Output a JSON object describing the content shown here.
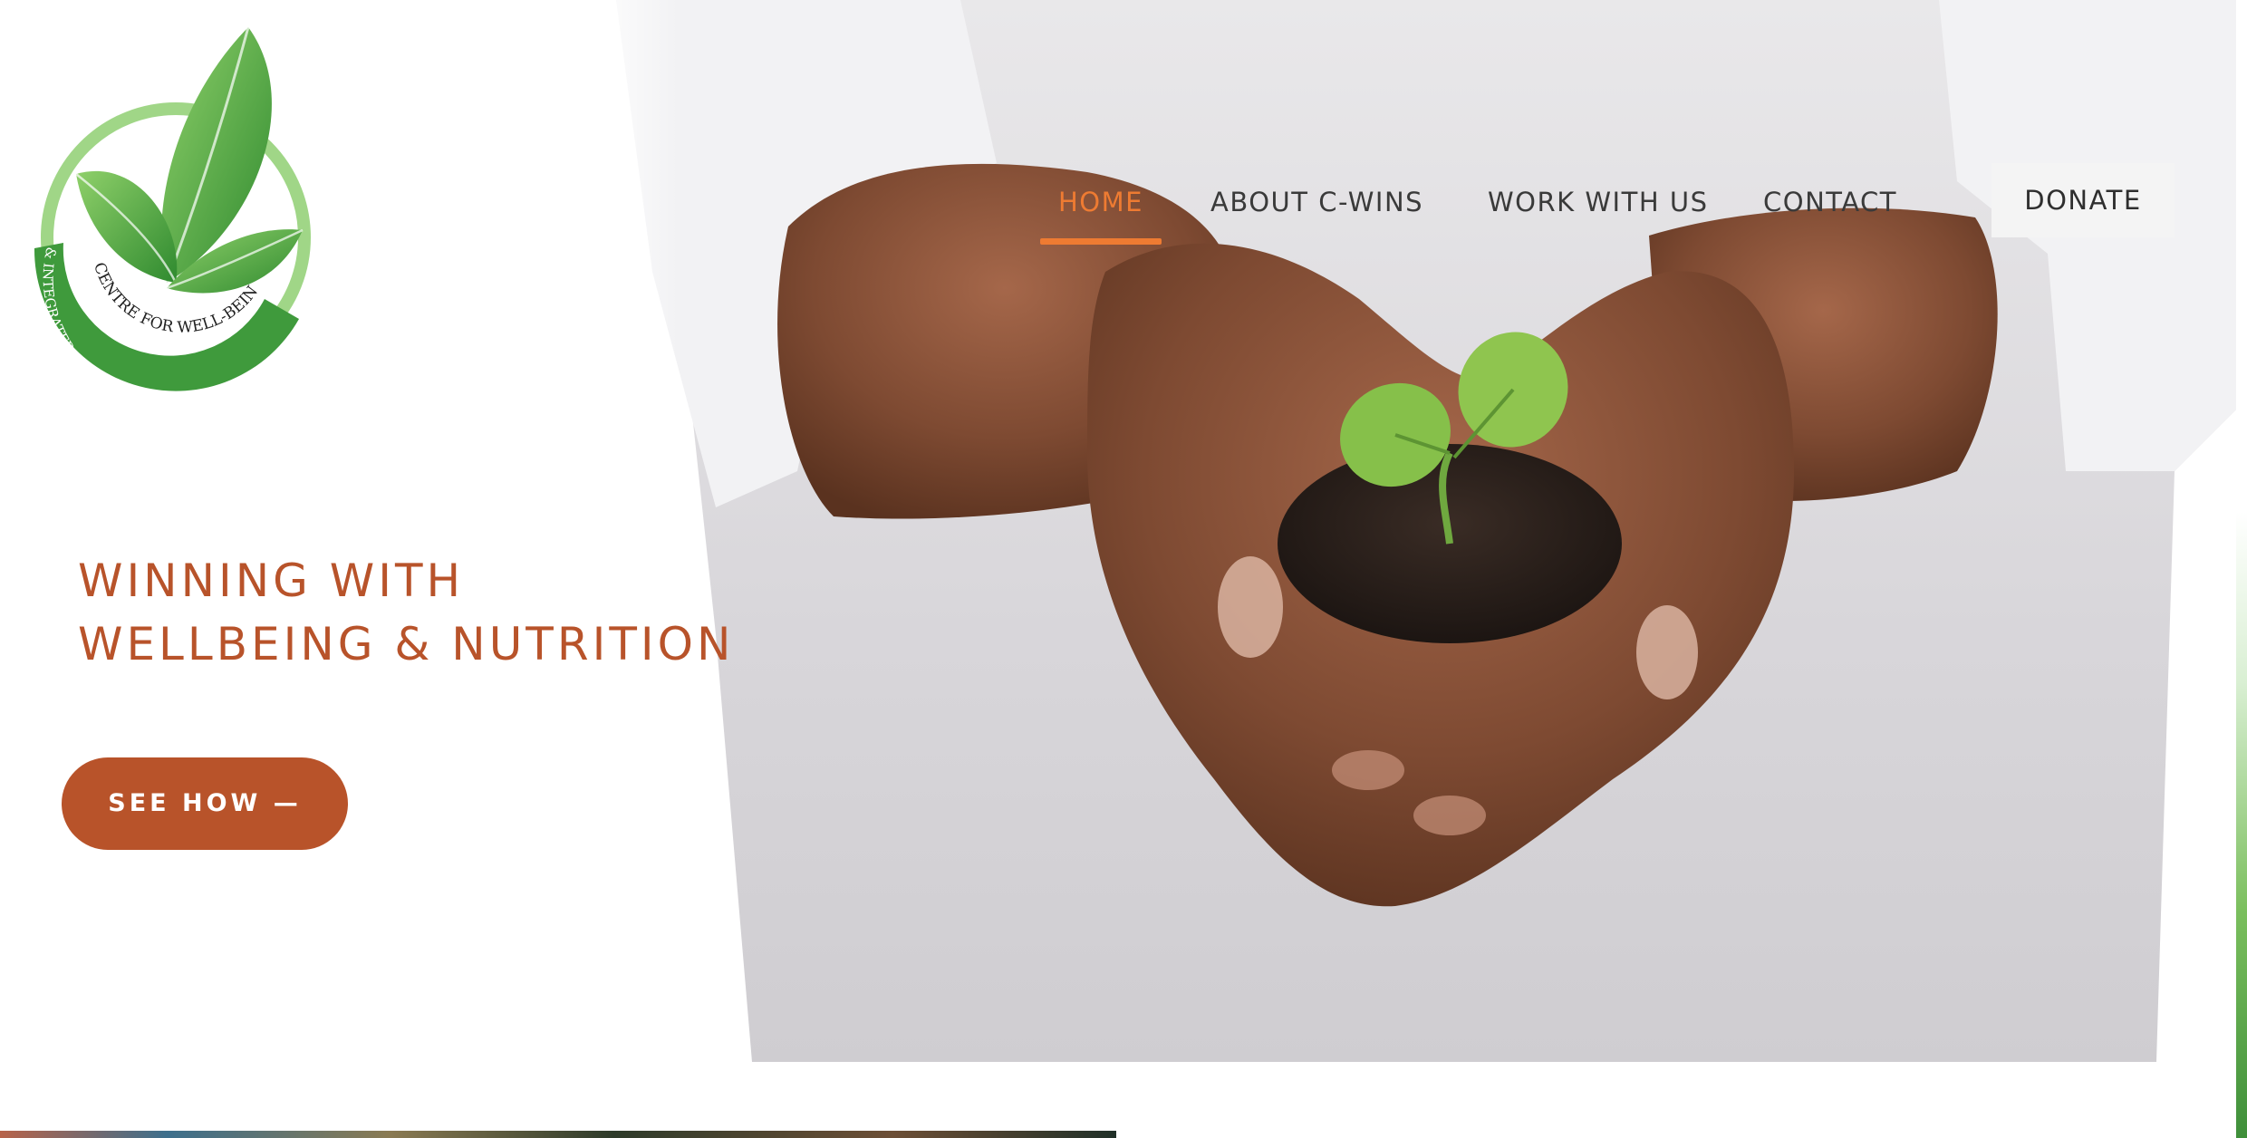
{
  "brand": {
    "logo_text_line1": "CENTRE FOR WELL-BEING",
    "logo_text_line2": "& INTEGRATED NUTRITION SOLUTIONS",
    "accent_color": "#ee7b32",
    "primary_color": "#b8532a",
    "logo_green": "#3f9a3c"
  },
  "nav": {
    "items": [
      {
        "label": "HOME",
        "active": true
      },
      {
        "label": "ABOUT C-WINS",
        "active": false
      },
      {
        "label": "WORK WITH US",
        "active": false
      },
      {
        "label": "CONTACT",
        "active": false
      }
    ],
    "donate_label": "DONATE"
  },
  "hero": {
    "headline_line1": "WINNING WITH",
    "headline_line2": "WELLBEING & NUTRITION",
    "cta_label": "SEE HOW —",
    "image_icon": "hands-holding-seedling"
  }
}
